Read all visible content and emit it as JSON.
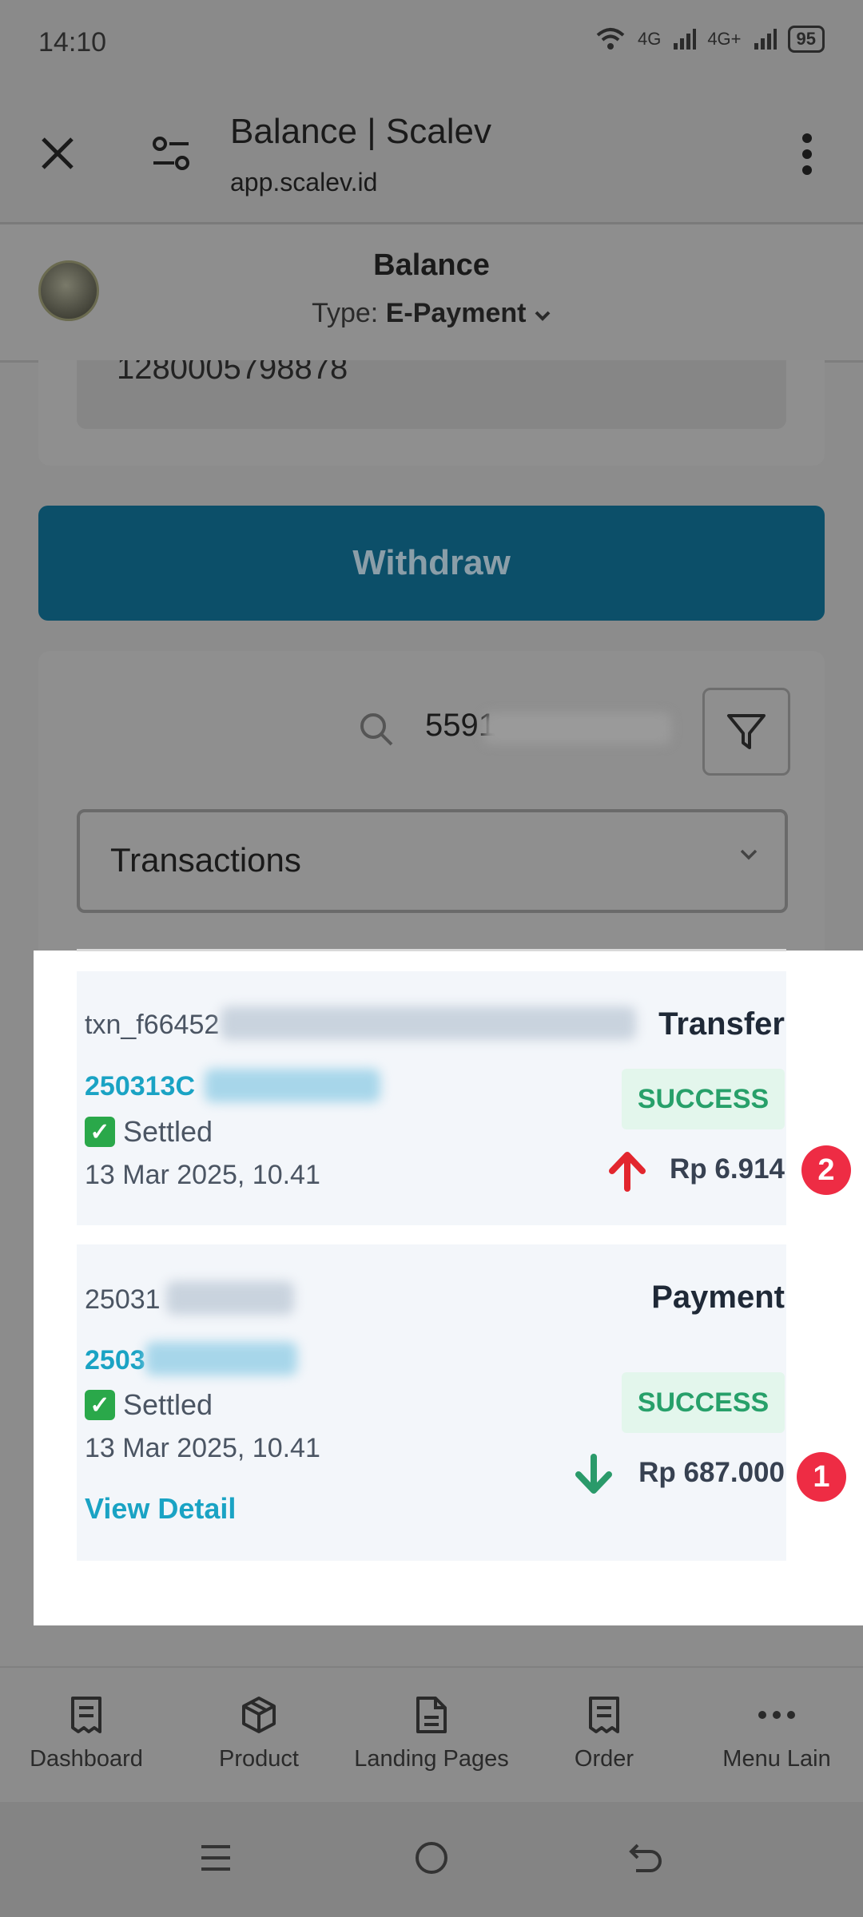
{
  "status_bar": {
    "time": "14:10",
    "network_1": "4G",
    "network_2": "4G+",
    "battery": "95"
  },
  "browser": {
    "title": "Balance | Scalev",
    "url": "app.scalev.id"
  },
  "header": {
    "title": "Balance",
    "type_label": "Type:",
    "type_value": "E-Payment"
  },
  "account": {
    "number_partial": "1280005798878"
  },
  "withdraw_label": "Withdraw",
  "search": {
    "value": "5591"
  },
  "select": {
    "value": "Transactions"
  },
  "transactions": [
    {
      "id_prefix": "txn_f66452",
      "link_prefix": "250313C",
      "settled": "Settled",
      "date": "13 Mar 2025, 10.41",
      "type": "Transfer",
      "status": "SUCCESS",
      "amount": "Rp 6.914",
      "direction": "up",
      "marker": "2"
    },
    {
      "id_prefix": "25031",
      "link_prefix": "2503",
      "settled": "Settled",
      "date": "13 Mar 2025, 10.41",
      "type": "Payment",
      "status": "SUCCESS",
      "amount": "Rp 687.000",
      "direction": "down",
      "marker": "1",
      "view_detail": "View Detail"
    }
  ],
  "bottom_nav": [
    {
      "label": "Dashboard",
      "icon": "receipt-icon"
    },
    {
      "label": "Product",
      "icon": "box-icon"
    },
    {
      "label": "Landing Pages",
      "icon": "document-icon"
    },
    {
      "label": "Order",
      "icon": "receipt-icon"
    },
    {
      "label": "Menu Lain",
      "icon": "more-icon"
    }
  ],
  "colors": {
    "primary": "#0c4f69",
    "link": "#1aa3c4",
    "success": "#27a06a",
    "up_arrow": "#e2262e",
    "down_arrow": "#2a9a6a",
    "marker": "#ee2c44"
  }
}
